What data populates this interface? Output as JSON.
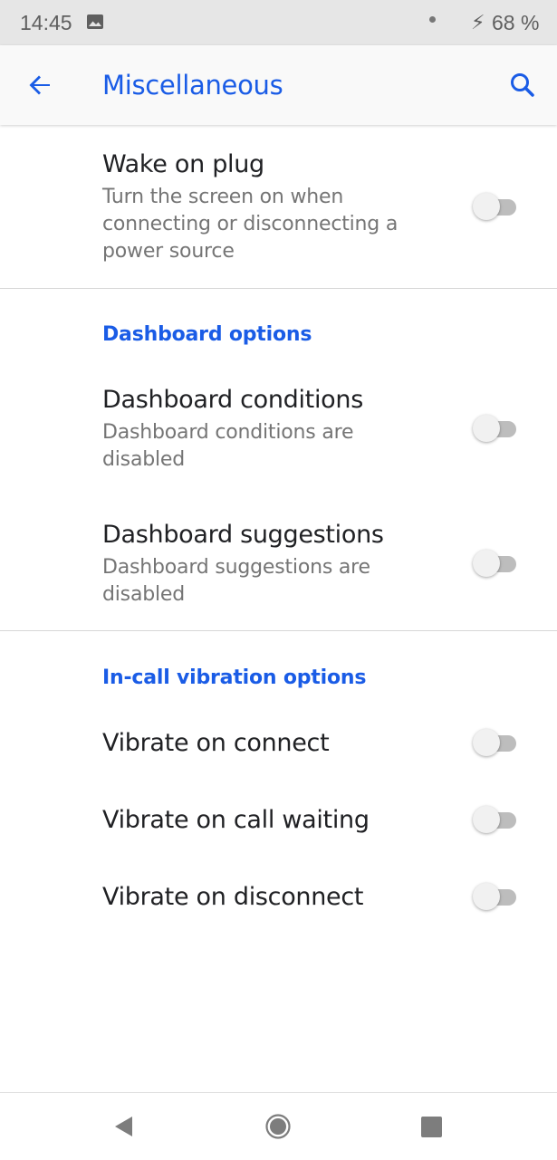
{
  "status_bar": {
    "time": "14:45",
    "battery": "68 %",
    "icons": [
      "image-icon",
      "notification-dot-icon",
      "charging-icon"
    ]
  },
  "app_bar": {
    "title": "Miscellaneous",
    "back_icon": "arrow-back-icon",
    "search_icon": "search-icon"
  },
  "settings": {
    "wake_on_plug": {
      "title": "Wake on plug",
      "summary": "Turn the screen on when connecting or disconnecting a power source",
      "enabled": false
    },
    "dashboard_section": {
      "header": "Dashboard options",
      "conditions": {
        "title": "Dashboard conditions",
        "summary": "Dashboard conditions are disabled",
        "enabled": false
      },
      "suggestions": {
        "title": "Dashboard suggestions",
        "summary": "Dashboard suggestions are disabled",
        "enabled": false
      }
    },
    "vibration_section": {
      "header": "In-call vibration options",
      "connect": {
        "title": "Vibrate on connect",
        "enabled": false
      },
      "call_waiting": {
        "title": "Vibrate on call waiting",
        "enabled": false
      },
      "disconnect": {
        "title": "Vibrate on disconnect",
        "enabled": false
      }
    }
  },
  "nav_bar": {
    "icons": [
      "nav-back-icon",
      "nav-home-icon",
      "nav-recents-icon"
    ]
  },
  "colors": {
    "accent": "#1a5ce6",
    "status_bar_bg": "#e6e6e6",
    "app_bar_bg": "#f9f9f9",
    "switch_off_track": "#bdbdbd",
    "switch_off_thumb": "#f1f1f1"
  }
}
